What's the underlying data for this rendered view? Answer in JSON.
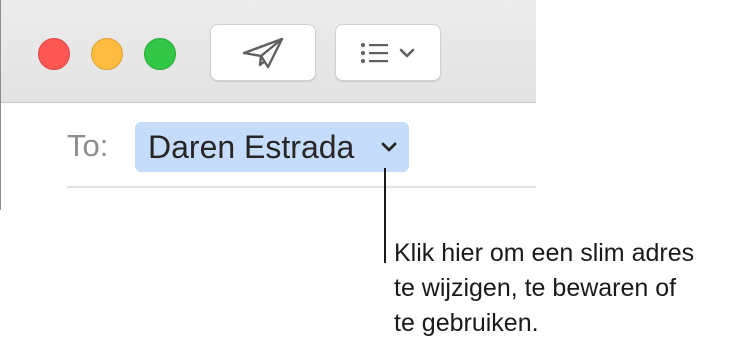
{
  "window": {
    "buttons": {
      "close": "close",
      "minimize": "minimize",
      "zoom": "zoom"
    }
  },
  "toolbar": {
    "send_icon": "paper-plane-icon",
    "format_icon": "list-icon",
    "format_dropdown_icon": "chevron-down-icon"
  },
  "compose": {
    "to_label": "To:",
    "recipient": "Daren Estrada",
    "recipient_chevron_icon": "chevron-down-icon"
  },
  "callout": {
    "lines": [
      "Klik hier om een slim adres",
      "te wijzigen, te bewaren of",
      "te gebruiken."
    ]
  },
  "colors": {
    "close": "#fc5753",
    "minimize": "#fdbc40",
    "zoom": "#33c748",
    "token_background": "#c6dcfb"
  }
}
